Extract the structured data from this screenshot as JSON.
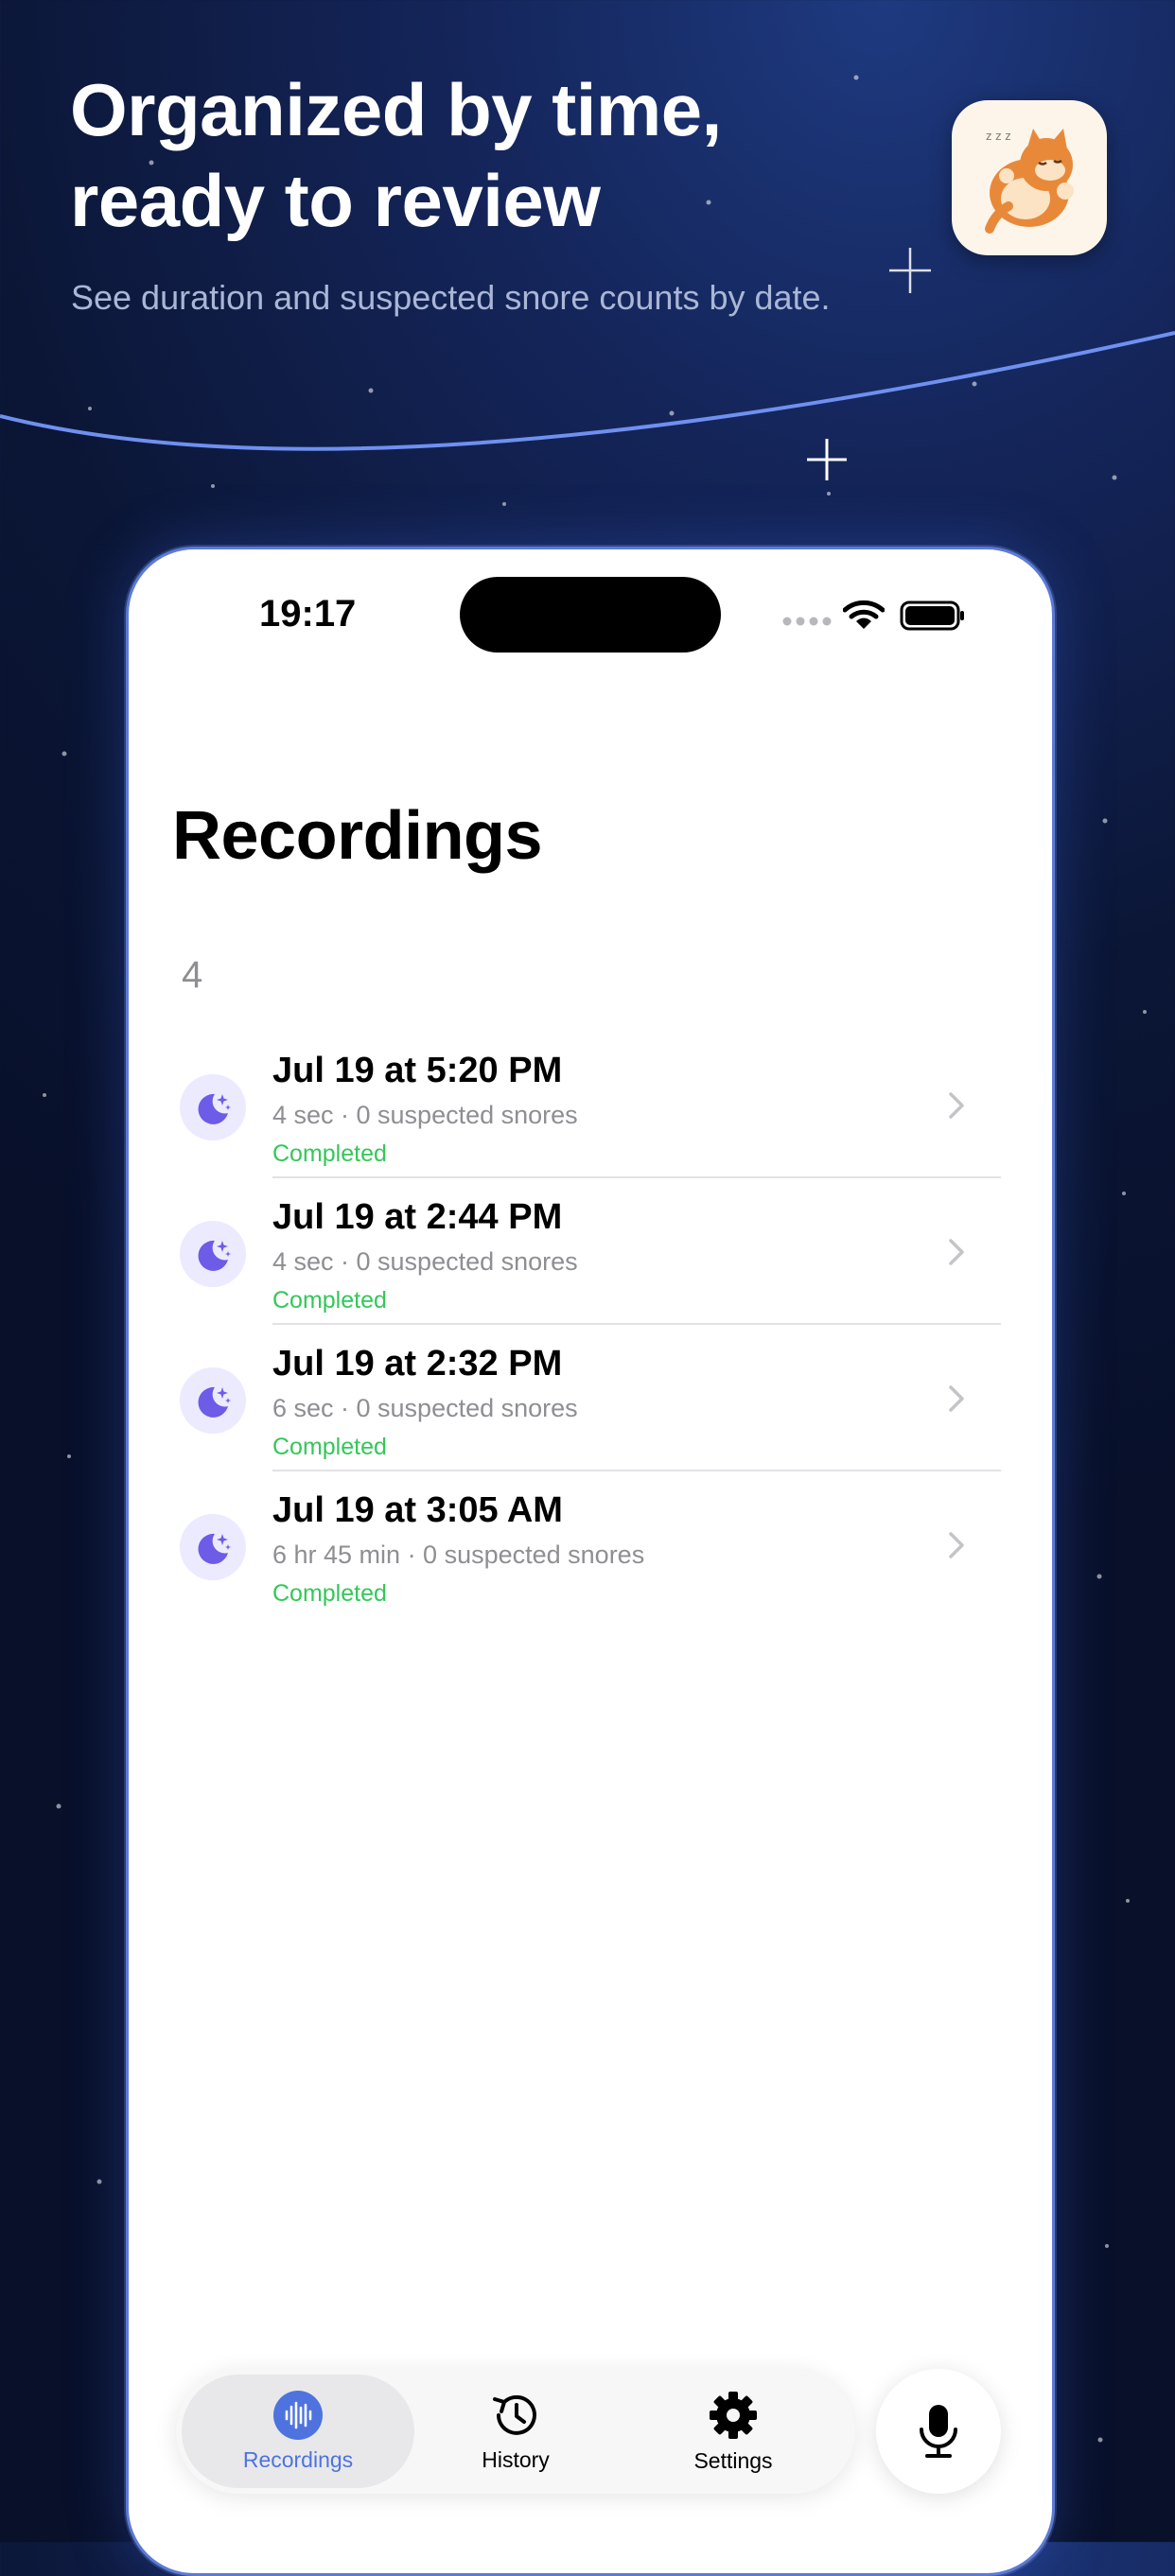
{
  "promo": {
    "headline_line1": "Organized by time,",
    "headline_line2": "ready to review",
    "subheadline": "See duration and suspected snore counts by date."
  },
  "app_icon": "sleeping-cat-app-icon",
  "status_bar": {
    "time": "19:17",
    "icons": [
      "signal-icon",
      "wifi-icon",
      "battery-icon"
    ]
  },
  "screen": {
    "title": "Recordings",
    "count": "4"
  },
  "recordings": [
    {
      "title": "Jul 19 at 5:20 PM",
      "subtitle": "4 sec · 0 suspected snores",
      "status": "Completed",
      "icon": "moon-stars-icon"
    },
    {
      "title": "Jul 19 at 2:44 PM",
      "subtitle": "4 sec · 0 suspected snores",
      "status": "Completed",
      "icon": "moon-stars-icon"
    },
    {
      "title": "Jul 19 at 2:32 PM",
      "subtitle": "6 sec · 0 suspected snores",
      "status": "Completed",
      "icon": "moon-stars-icon"
    },
    {
      "title": "Jul 19 at 3:05 AM",
      "subtitle": "6 hr 45 min · 0 suspected snores",
      "status": "Completed",
      "icon": "moon-stars-icon"
    }
  ],
  "tabs": [
    {
      "label": "Recordings",
      "icon": "waveform-icon",
      "active": true
    },
    {
      "label": "History",
      "icon": "history-clock-icon",
      "active": false
    },
    {
      "label": "Settings",
      "icon": "gear-icon",
      "active": false
    }
  ],
  "record_button_icon": "microphone-icon",
  "colors": {
    "accent": "#4e73df",
    "status_completed": "#34c759",
    "moon_icon": "#6c5ce7",
    "background_dark": "#0b1636"
  }
}
